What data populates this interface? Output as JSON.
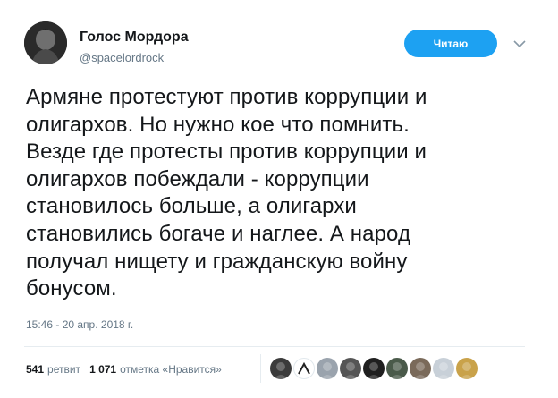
{
  "author": {
    "display_name": "Голос Мордора",
    "username": "@spacelordrock"
  },
  "follow_button": {
    "label": "Читаю"
  },
  "tweet": {
    "text": "Армяне протестуют против коррупции и\nолигархов. Но нужно кое что помнить.\nВезде где протесты против коррупции и\nолигархов побеждали - коррупции\nстановилось больше, а олигархи\nстановились богаче и наглее. А народ\nполучал нищету и гражданскую войну\nбонусом.",
    "timestamp": "15:46 - 20 апр. 2018 г."
  },
  "stats": {
    "retweets_count": "541",
    "retweets_label": "ретвит",
    "likes_count": "1 071",
    "likes_label": "отметка «Нравится»"
  },
  "liker_avatars": [
    {
      "name": "liker-avatar-1",
      "color": "#3b3b3b"
    },
    {
      "name": "liker-avatar-2",
      "color": "#ffffff"
    },
    {
      "name": "liker-avatar-3",
      "color": "#9aa3ad"
    },
    {
      "name": "liker-avatar-4",
      "color": "#555555"
    },
    {
      "name": "liker-avatar-5",
      "color": "#1f1f1f"
    },
    {
      "name": "liker-avatar-6",
      "color": "#4a5a4a"
    },
    {
      "name": "liker-avatar-7",
      "color": "#7a6a5a"
    },
    {
      "name": "liker-avatar-8",
      "color": "#c8d0d8"
    },
    {
      "name": "liker-avatar-9",
      "color": "#c9a24a"
    }
  ],
  "colors": {
    "accent": "#1da1f2",
    "secondary_text": "#657786",
    "primary_text": "#14171a"
  }
}
